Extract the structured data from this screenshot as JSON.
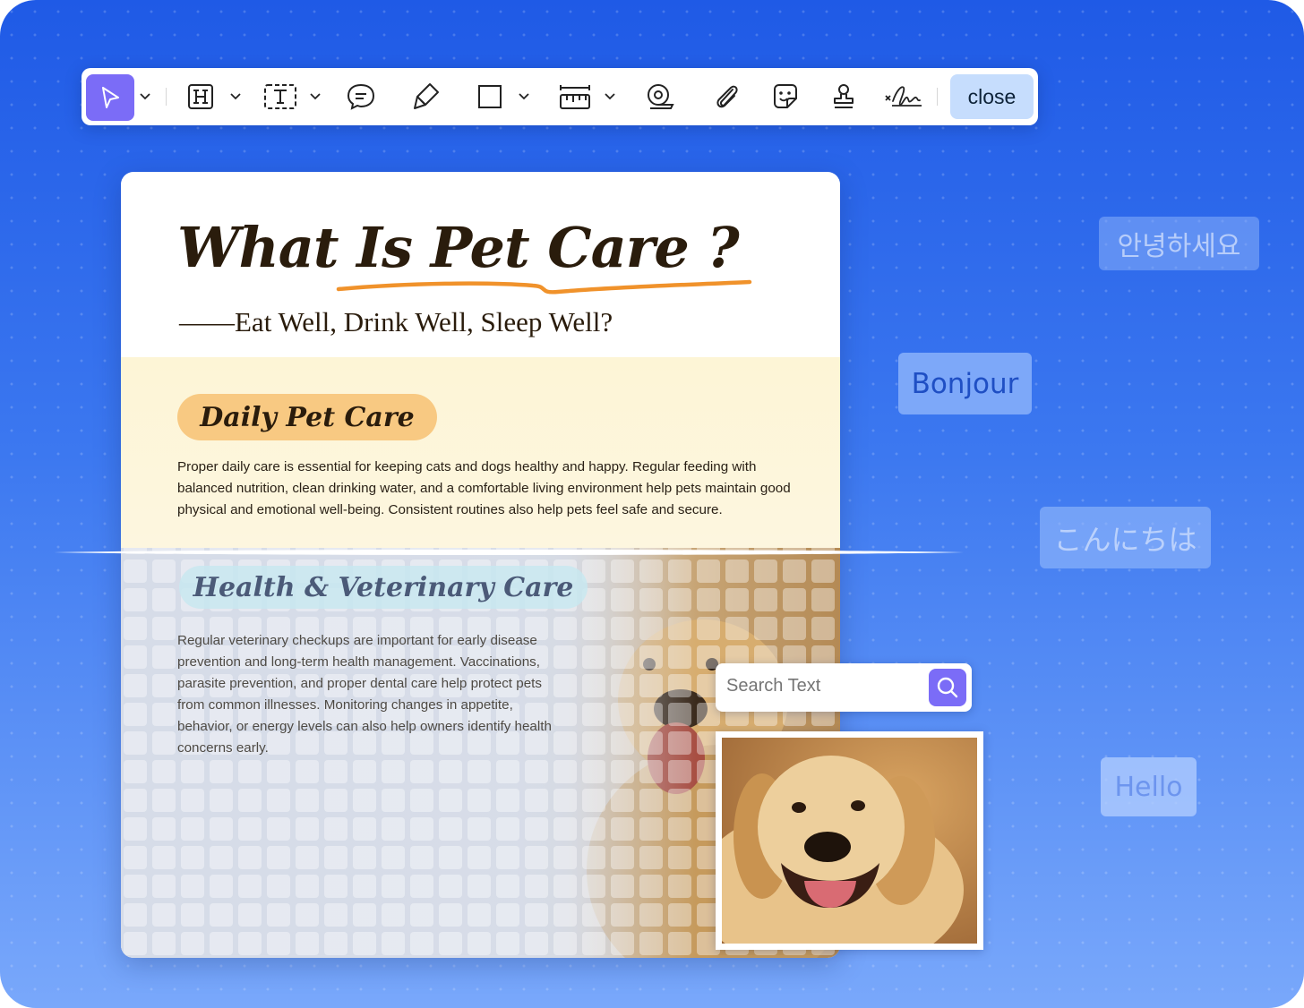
{
  "toolbar": {
    "tools": [
      {
        "name": "select-tool",
        "icon": "cursor-arrow-icon",
        "dropdown": true,
        "active": true
      },
      {
        "name": "heading-tool",
        "icon": "heading-h-icon",
        "dropdown": true
      },
      {
        "name": "text-box-tool",
        "icon": "text-box-icon",
        "dropdown": true
      },
      {
        "name": "comment-tool",
        "icon": "speech-bubble-icon",
        "dropdown": false
      },
      {
        "name": "highlighter-tool",
        "icon": "highlighter-icon",
        "dropdown": false
      },
      {
        "name": "shape-tool",
        "icon": "rectangle-icon",
        "dropdown": true
      },
      {
        "name": "measure-tool",
        "icon": "ruler-icon",
        "dropdown": true
      },
      {
        "name": "tape-tool",
        "icon": "tape-roll-icon",
        "dropdown": false
      },
      {
        "name": "attach-tool",
        "icon": "paperclip-icon",
        "dropdown": false
      },
      {
        "name": "sticker-tool",
        "icon": "sticker-smile-icon",
        "dropdown": false
      },
      {
        "name": "stamp-tool",
        "icon": "stamp-icon",
        "dropdown": false
      },
      {
        "name": "signature-tool",
        "icon": "signature-icon",
        "dropdown": false
      }
    ],
    "close_label": "close",
    "accent_color": "#7b6cf7"
  },
  "document": {
    "title": "What Is Pet Care ?",
    "subtitle": "——Eat Well, Drink Well, Sleep Well?",
    "sections": [
      {
        "heading": "Daily Pet Care",
        "body": "Proper daily care is essential for keeping cats and dogs healthy and happy. Regular feeding with balanced nutrition, clean drinking water, and a comfortable living environment help pets maintain good physical and emotional well-being. Consistent routines also help pets feel safe and secure."
      },
      {
        "heading": "Health & Veterinary Care",
        "body": "Regular veterinary checkups are important for early disease prevention and long-term health management. Vaccinations, parasite prevention, and proper dental care help protect pets from common illnesses. Monitoring changes in appetite, behavior, or energy levels can also help owners identify health concerns early."
      }
    ],
    "underline_color": "#f0922b"
  },
  "search": {
    "placeholder": "Search Text",
    "icon": "search-icon"
  },
  "translations": {
    "korean": "안녕하세요",
    "french": "Bonjour",
    "japanese": "こんにちは",
    "english": "Hello"
  }
}
